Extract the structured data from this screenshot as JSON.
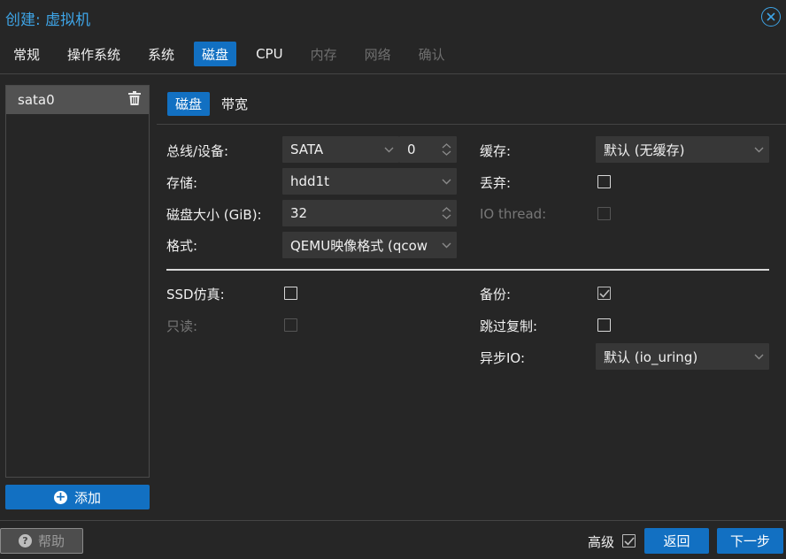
{
  "window": {
    "title": "创建: 虚拟机"
  },
  "top_tabs": [
    {
      "label": "常规",
      "state": "normal"
    },
    {
      "label": "操作系统",
      "state": "normal"
    },
    {
      "label": "系统",
      "state": "normal"
    },
    {
      "label": "磁盘",
      "state": "active"
    },
    {
      "label": "CPU",
      "state": "normal"
    },
    {
      "label": "内存",
      "state": "disabled"
    },
    {
      "label": "网络",
      "state": "disabled"
    },
    {
      "label": "确认",
      "state": "disabled"
    }
  ],
  "disk_list": {
    "items": [
      {
        "label": "sata0"
      }
    ],
    "add_label": "添加"
  },
  "sub_tabs": [
    {
      "label": "磁盘",
      "state": "active"
    },
    {
      "label": "带宽",
      "state": "normal"
    }
  ],
  "form": {
    "bus_label": "总线/设备:",
    "bus_value": "SATA",
    "device_value": "0",
    "storage_label": "存储:",
    "storage_value": "hdd1t",
    "size_label": "磁盘大小 (GiB):",
    "size_value": "32",
    "format_label": "格式:",
    "format_value": "QEMU映像格式 (qcow",
    "cache_label": "缓存:",
    "cache_value": "默认 (无缓存)",
    "discard_label": "丢弃:",
    "discard_checked": false,
    "iothread_label": "IO thread:",
    "iothread_checked": false,
    "ssd_label": "SSD仿真:",
    "ssd_checked": false,
    "readonly_label": "只读:",
    "readonly_checked": false,
    "backup_label": "备份:",
    "backup_checked": true,
    "skip_replication_label": "跳过复制:",
    "skip_replication_checked": false,
    "async_io_label": "异步IO:",
    "async_io_value": "默认 (io_uring)"
  },
  "footer": {
    "help_label": "帮助",
    "advanced_label": "高级",
    "advanced_checked": true,
    "back_label": "返回",
    "next_label": "下一步"
  },
  "colors": {
    "accent": "#1270c2",
    "title": "#3ea4e6",
    "background": "#262626",
    "field": "#373737"
  }
}
